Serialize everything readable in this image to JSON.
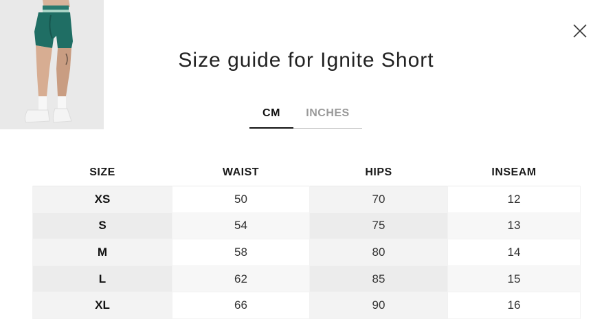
{
  "modal": {
    "title": "Size guide for Ignite Short",
    "close_icon": "close-icon",
    "image_icon": "product-photo"
  },
  "tabs": [
    {
      "label": "CM",
      "active": true
    },
    {
      "label": "INCHES",
      "active": false
    }
  ],
  "table": {
    "headers": [
      "SIZE",
      "WAIST",
      "HIPS",
      "INSEAM"
    ],
    "rows": [
      [
        "XS",
        "50",
        "70",
        "12"
      ],
      [
        "S",
        "54",
        "75",
        "13"
      ],
      [
        "M",
        "58",
        "80",
        "14"
      ],
      [
        "L",
        "62",
        "85",
        "15"
      ],
      [
        "XL",
        "66",
        "90",
        "16"
      ]
    ]
  },
  "colors": {
    "short_green": "#1f6e64",
    "active_tab": "#111111",
    "inactive_tab": "#9a9a9a"
  }
}
